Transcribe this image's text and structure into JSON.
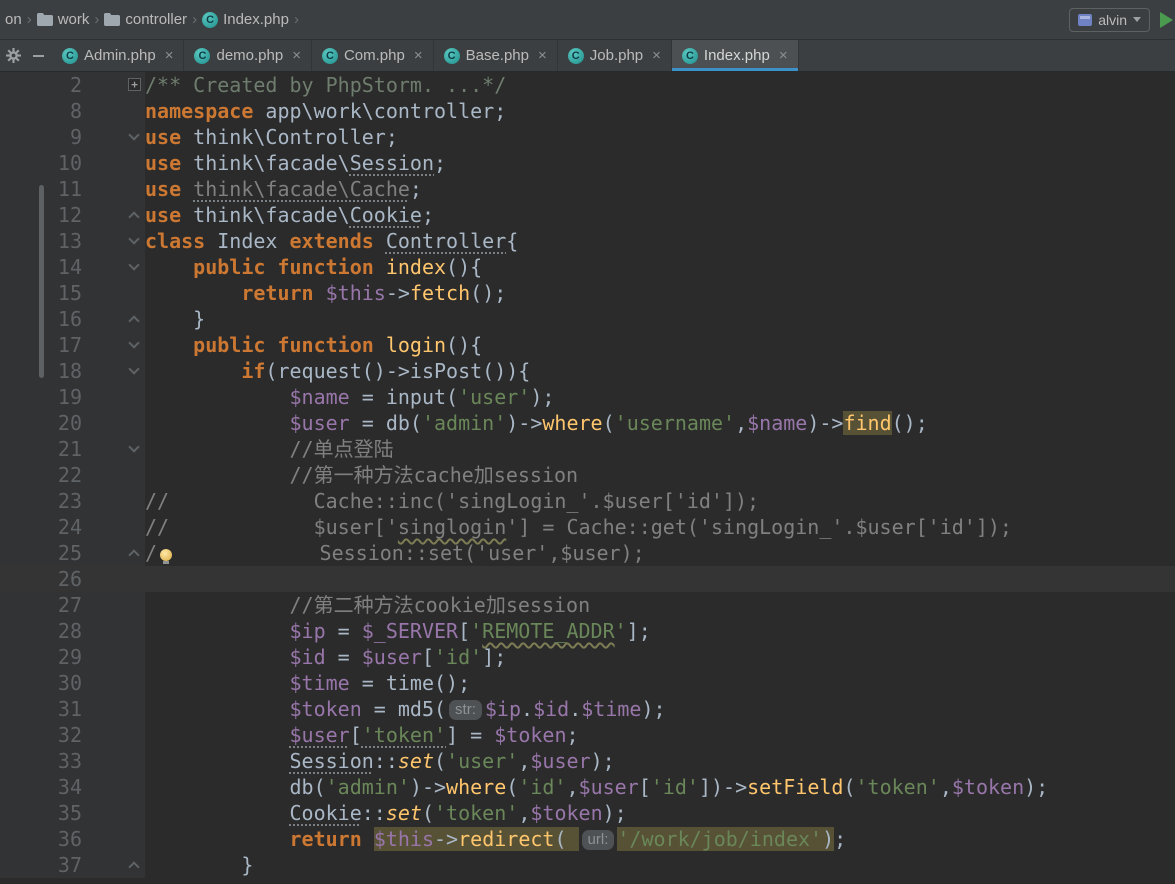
{
  "colors": {
    "bg": "#2B2B2B",
    "bar": "#3C3F41",
    "gutter": "#313335",
    "accent": "#3C91C9",
    "kw": "#CC7832",
    "str": "#6A8759",
    "vr": "#9876AA",
    "fn": "#FFC66D",
    "cm": "#808080",
    "hl": "#575135",
    "green": "#4A9B50"
  },
  "breadcrumb_bar": {
    "separator": "›",
    "items": [
      {
        "label": "on",
        "icon": "none"
      },
      {
        "label": "work",
        "icon": "folder"
      },
      {
        "label": "controller",
        "icon": "folder"
      },
      {
        "label": "Index.php",
        "icon": "php-class"
      }
    ],
    "run_config": {
      "name": "alvin"
    }
  },
  "tab_bar": {
    "class_icon_letter": "C",
    "close_glyph": "×",
    "tabs": [
      {
        "label": "Admin.php",
        "active": false
      },
      {
        "label": "demo.php",
        "active": false
      },
      {
        "label": "Com.php",
        "active": false
      },
      {
        "label": "Base.php",
        "active": false
      },
      {
        "label": "Job.php",
        "active": false
      },
      {
        "label": "Index.php",
        "active": true
      }
    ]
  },
  "editor": {
    "lines": [
      {
        "n": 2,
        "fold": "plus",
        "tokens": [
          {
            "t": "/** Created by PhpStorm. ...*/",
            "c": "doc"
          }
        ]
      },
      {
        "n": 8,
        "fold": "none",
        "tokens": [
          {
            "t": "namespace ",
            "c": "k"
          },
          {
            "t": "app\\work\\controller;",
            "c": "p"
          }
        ]
      },
      {
        "n": 9,
        "fold": "down",
        "tokens": [
          {
            "t": "use ",
            "c": "k"
          },
          {
            "t": "think\\Controller;",
            "c": "p"
          }
        ]
      },
      {
        "n": 10,
        "fold": "none",
        "tokens": [
          {
            "t": "use ",
            "c": "k"
          },
          {
            "t": "think\\facade\\",
            "c": "p"
          },
          {
            "t": "Session",
            "c": "p",
            "u": "dot"
          },
          {
            "t": ";",
            "c": "p"
          }
        ]
      },
      {
        "n": 11,
        "fold": "none",
        "tokens": [
          {
            "t": "use ",
            "c": "k"
          },
          {
            "t": "think\\facade\\Cache",
            "c": "c",
            "u": "dot"
          },
          {
            "t": ";",
            "c": "p"
          }
        ]
      },
      {
        "n": 12,
        "fold": "up",
        "tokens": [
          {
            "t": "use ",
            "c": "k"
          },
          {
            "t": "think\\facade\\",
            "c": "p"
          },
          {
            "t": "Cookie",
            "c": "p",
            "u": "dot"
          },
          {
            "t": ";",
            "c": "p"
          }
        ]
      },
      {
        "n": 13,
        "fold": "down",
        "tokens": [
          {
            "t": "class ",
            "c": "k"
          },
          {
            "t": "Index ",
            "c": "p"
          },
          {
            "t": "extends ",
            "c": "k"
          },
          {
            "t": "Controller",
            "c": "p",
            "u": "dot"
          },
          {
            "t": "{",
            "c": "p"
          }
        ]
      },
      {
        "n": 14,
        "fold": "down",
        "tokens": [
          {
            "t": "    ",
            "c": "p"
          },
          {
            "t": "public function ",
            "c": "k"
          },
          {
            "t": "index",
            "c": "f"
          },
          {
            "t": "(){",
            "c": "p"
          }
        ]
      },
      {
        "n": 15,
        "fold": "none",
        "tokens": [
          {
            "t": "        ",
            "c": "p"
          },
          {
            "t": "return ",
            "c": "k"
          },
          {
            "t": "$this",
            "c": "v"
          },
          {
            "t": "->",
            "c": "p"
          },
          {
            "t": "fetch",
            "c": "f"
          },
          {
            "t": "();",
            "c": "p"
          }
        ]
      },
      {
        "n": 16,
        "fold": "up",
        "tokens": [
          {
            "t": "    }",
            "c": "p"
          }
        ]
      },
      {
        "n": 17,
        "fold": "down",
        "tokens": [
          {
            "t": "    ",
            "c": "p"
          },
          {
            "t": "public function ",
            "c": "k"
          },
          {
            "t": "login",
            "c": "f"
          },
          {
            "t": "(){",
            "c": "p"
          }
        ]
      },
      {
        "n": 18,
        "fold": "down",
        "tokens": [
          {
            "t": "        ",
            "c": "p"
          },
          {
            "t": "if",
            "c": "k"
          },
          {
            "t": "(request()->isPost()){",
            "c": "p"
          }
        ]
      },
      {
        "n": 19,
        "fold": "none",
        "tokens": [
          {
            "t": "            ",
            "c": "p"
          },
          {
            "t": "$name",
            "c": "v"
          },
          {
            "t": " = input(",
            "c": "p"
          },
          {
            "t": "'user'",
            "c": "s"
          },
          {
            "t": ");",
            "c": "p"
          }
        ]
      },
      {
        "n": 20,
        "fold": "none",
        "tokens": [
          {
            "t": "            ",
            "c": "p"
          },
          {
            "t": "$user",
            "c": "v"
          },
          {
            "t": " = db(",
            "c": "p"
          },
          {
            "t": "'admin'",
            "c": "s"
          },
          {
            "t": ")->",
            "c": "p"
          },
          {
            "t": "where",
            "c": "f"
          },
          {
            "t": "(",
            "c": "p"
          },
          {
            "t": "'username'",
            "c": "s"
          },
          {
            "t": ",",
            "c": "p"
          },
          {
            "t": "$name",
            "c": "v"
          },
          {
            "t": ")->",
            "c": "p"
          },
          {
            "t": "find",
            "c": "f",
            "hl": true
          },
          {
            "t": "();",
            "c": "p"
          }
        ]
      },
      {
        "n": 21,
        "fold": "down",
        "tokens": [
          {
            "t": "            ",
            "c": "p"
          },
          {
            "t": "//单点登陆",
            "c": "c"
          }
        ]
      },
      {
        "n": 22,
        "fold": "none",
        "tokens": [
          {
            "t": "            ",
            "c": "p"
          },
          {
            "t": "//第一种方法cache加session",
            "c": "c"
          }
        ]
      },
      {
        "n": 23,
        "fold": "none",
        "tokens": [
          {
            "t": "//            Cache::inc('singLogin_'.$user['id']);",
            "c": "c"
          }
        ]
      },
      {
        "n": 24,
        "fold": "none",
        "tokens": [
          {
            "t": "//            $user['",
            "c": "c"
          },
          {
            "t": "singlogin",
            "c": "c",
            "u": "wave"
          },
          {
            "t": "'] = Cache::get('singLogin_'.$user['id']);",
            "c": "c"
          }
        ]
      },
      {
        "n": 25,
        "fold": "up",
        "tokens": [
          {
            "t": "/",
            "c": "c"
          },
          {
            "icon": "bulb"
          },
          {
            "t": "            Session::set('user',$user);",
            "c": "c"
          }
        ]
      },
      {
        "n": 26,
        "fold": "none",
        "current": true,
        "tokens": []
      },
      {
        "n": 27,
        "fold": "none",
        "tokens": [
          {
            "t": "            ",
            "c": "p"
          },
          {
            "t": "//第二种方法cookie加session",
            "c": "c"
          }
        ]
      },
      {
        "n": 28,
        "fold": "none",
        "tokens": [
          {
            "t": "            ",
            "c": "p"
          },
          {
            "t": "$ip",
            "c": "v"
          },
          {
            "t": " = ",
            "c": "p"
          },
          {
            "t": "$_SERVER",
            "c": "v"
          },
          {
            "t": "[",
            "c": "p"
          },
          {
            "t": "'",
            "c": "s"
          },
          {
            "t": "REMOTE_ADDR",
            "c": "s",
            "u": "wave"
          },
          {
            "t": "'",
            "c": "s"
          },
          {
            "t": "];",
            "c": "p"
          }
        ]
      },
      {
        "n": 29,
        "fold": "none",
        "tokens": [
          {
            "t": "            ",
            "c": "p"
          },
          {
            "t": "$id",
            "c": "v"
          },
          {
            "t": " = ",
            "c": "p"
          },
          {
            "t": "$user",
            "c": "v"
          },
          {
            "t": "[",
            "c": "p"
          },
          {
            "t": "'id'",
            "c": "s"
          },
          {
            "t": "];",
            "c": "p"
          }
        ]
      },
      {
        "n": 30,
        "fold": "none",
        "tokens": [
          {
            "t": "            ",
            "c": "p"
          },
          {
            "t": "$time",
            "c": "v"
          },
          {
            "t": " = time();",
            "c": "p"
          }
        ]
      },
      {
        "n": 31,
        "fold": "none",
        "tokens": [
          {
            "t": "            ",
            "c": "p"
          },
          {
            "t": "$token",
            "c": "v"
          },
          {
            "t": " = md5(",
            "c": "p"
          },
          {
            "t": "str:",
            "chip": true
          },
          {
            "t": "$ip",
            "c": "v"
          },
          {
            "t": ".",
            "c": "p"
          },
          {
            "t": "$id",
            "c": "v"
          },
          {
            "t": ".",
            "c": "p"
          },
          {
            "t": "$time",
            "c": "v"
          },
          {
            "t": ");",
            "c": "p"
          }
        ]
      },
      {
        "n": 32,
        "fold": "none",
        "tokens": [
          {
            "t": "            ",
            "c": "p"
          },
          {
            "t": "$user",
            "c": "v",
            "u": "dot"
          },
          {
            "t": "[",
            "c": "p"
          },
          {
            "t": "'token'",
            "c": "s",
            "u": "dot"
          },
          {
            "t": "] = ",
            "c": "p"
          },
          {
            "t": "$token",
            "c": "v"
          },
          {
            "t": ";",
            "c": "p"
          }
        ]
      },
      {
        "n": 33,
        "fold": "none",
        "tokens": [
          {
            "t": "            ",
            "c": "p"
          },
          {
            "t": "Session",
            "c": "p",
            "u": "dot"
          },
          {
            "t": "::",
            "c": "p"
          },
          {
            "t": "set",
            "c": "fi"
          },
          {
            "t": "(",
            "c": "p"
          },
          {
            "t": "'user'",
            "c": "s"
          },
          {
            "t": ",",
            "c": "p"
          },
          {
            "t": "$user",
            "c": "v"
          },
          {
            "t": ");",
            "c": "p"
          }
        ]
      },
      {
        "n": 34,
        "fold": "none",
        "tokens": [
          {
            "t": "            ",
            "c": "p"
          },
          {
            "t": "db(",
            "c": "p"
          },
          {
            "t": "'admin'",
            "c": "s"
          },
          {
            "t": ")->",
            "c": "p"
          },
          {
            "t": "where",
            "c": "f"
          },
          {
            "t": "(",
            "c": "p"
          },
          {
            "t": "'id'",
            "c": "s"
          },
          {
            "t": ",",
            "c": "p"
          },
          {
            "t": "$user",
            "c": "v"
          },
          {
            "t": "[",
            "c": "p"
          },
          {
            "t": "'id'",
            "c": "s"
          },
          {
            "t": "])->",
            "c": "p"
          },
          {
            "t": "setField",
            "c": "f"
          },
          {
            "t": "(",
            "c": "p"
          },
          {
            "t": "'token'",
            "c": "s"
          },
          {
            "t": ",",
            "c": "p"
          },
          {
            "t": "$token",
            "c": "v"
          },
          {
            "t": ");",
            "c": "p"
          }
        ]
      },
      {
        "n": 35,
        "fold": "none",
        "tokens": [
          {
            "t": "            ",
            "c": "p"
          },
          {
            "t": "Cookie",
            "c": "p",
            "u": "dot"
          },
          {
            "t": "::",
            "c": "p"
          },
          {
            "t": "set",
            "c": "fi"
          },
          {
            "t": "(",
            "c": "p"
          },
          {
            "t": "'token'",
            "c": "s"
          },
          {
            "t": ",",
            "c": "p"
          },
          {
            "t": "$token",
            "c": "v"
          },
          {
            "t": ");",
            "c": "p"
          }
        ]
      },
      {
        "n": 36,
        "fold": "none",
        "tokens": [
          {
            "t": "            ",
            "c": "p"
          },
          {
            "t": "return ",
            "c": "k"
          },
          {
            "t": "$this",
            "c": "v",
            "hl": true
          },
          {
            "t": "->",
            "c": "p",
            "hl": true
          },
          {
            "t": "redirect",
            "c": "f",
            "hl": true
          },
          {
            "t": "( ",
            "c": "p",
            "hl": true
          },
          {
            "t": "url:",
            "chip": true
          },
          {
            "t": "'/work/job/index'",
            "c": "s",
            "hl": true
          },
          {
            "t": ")",
            "c": "p",
            "hl": true
          },
          {
            "t": ";",
            "c": "p"
          }
        ]
      },
      {
        "n": 37,
        "fold": "up",
        "tokens": [
          {
            "t": "        }",
            "c": "p"
          }
        ]
      }
    ]
  }
}
